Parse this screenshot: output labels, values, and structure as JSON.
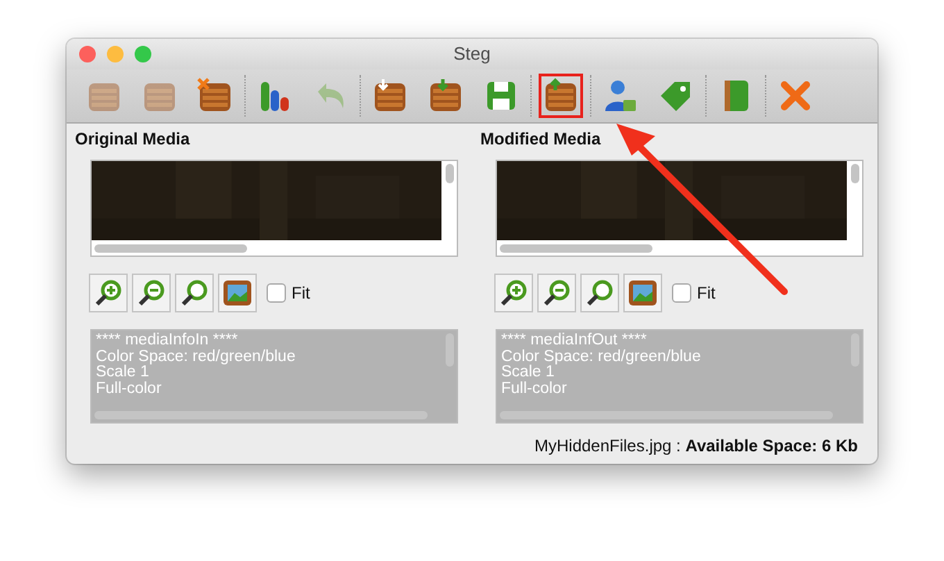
{
  "window": {
    "title": "Steg"
  },
  "toolbar": {
    "groups": [
      [
        {
          "kind": "crate-bmp",
          "disabled": true,
          "marked": false
        },
        {
          "kind": "crate",
          "disabled": true,
          "marked": false
        },
        {
          "kind": "crate-x",
          "disabled": false,
          "marked": false
        }
      ],
      [
        {
          "kind": "chart",
          "disabled": false,
          "marked": false
        },
        {
          "kind": "undo",
          "disabled": true,
          "marked": false
        }
      ],
      [
        {
          "kind": "crate-down",
          "disabled": false,
          "marked": false
        },
        {
          "kind": "crate-in",
          "disabled": false,
          "marked": false
        },
        {
          "kind": "save",
          "disabled": false,
          "marked": false
        }
      ],
      [
        {
          "kind": "crate-up",
          "disabled": false,
          "marked": true
        }
      ],
      [
        {
          "kind": "user-lock",
          "disabled": false,
          "marked": false
        },
        {
          "kind": "tag",
          "disabled": false,
          "marked": false
        }
      ],
      [
        {
          "kind": "notebook",
          "disabled": false,
          "marked": false
        }
      ],
      [
        {
          "kind": "close",
          "disabled": false,
          "marked": false
        }
      ]
    ]
  },
  "panels": [
    {
      "title": "Original Media",
      "fit": {
        "label": "Fit",
        "checked": false
      },
      "info": [
        "**** mediaInfoIn ****",
        "Color Space: red/green/blue",
        "Scale 1",
        "Full-color"
      ]
    },
    {
      "title": "Modified Media",
      "fit": {
        "label": "Fit",
        "checked": false
      },
      "info": [
        "**** mediaInfOut ****",
        "Color Space: red/green/blue",
        "Scale 1",
        "Full-color"
      ]
    }
  ],
  "status": "MyHiddenFiles.jpg : **Available Space: 6 Kb**"
}
